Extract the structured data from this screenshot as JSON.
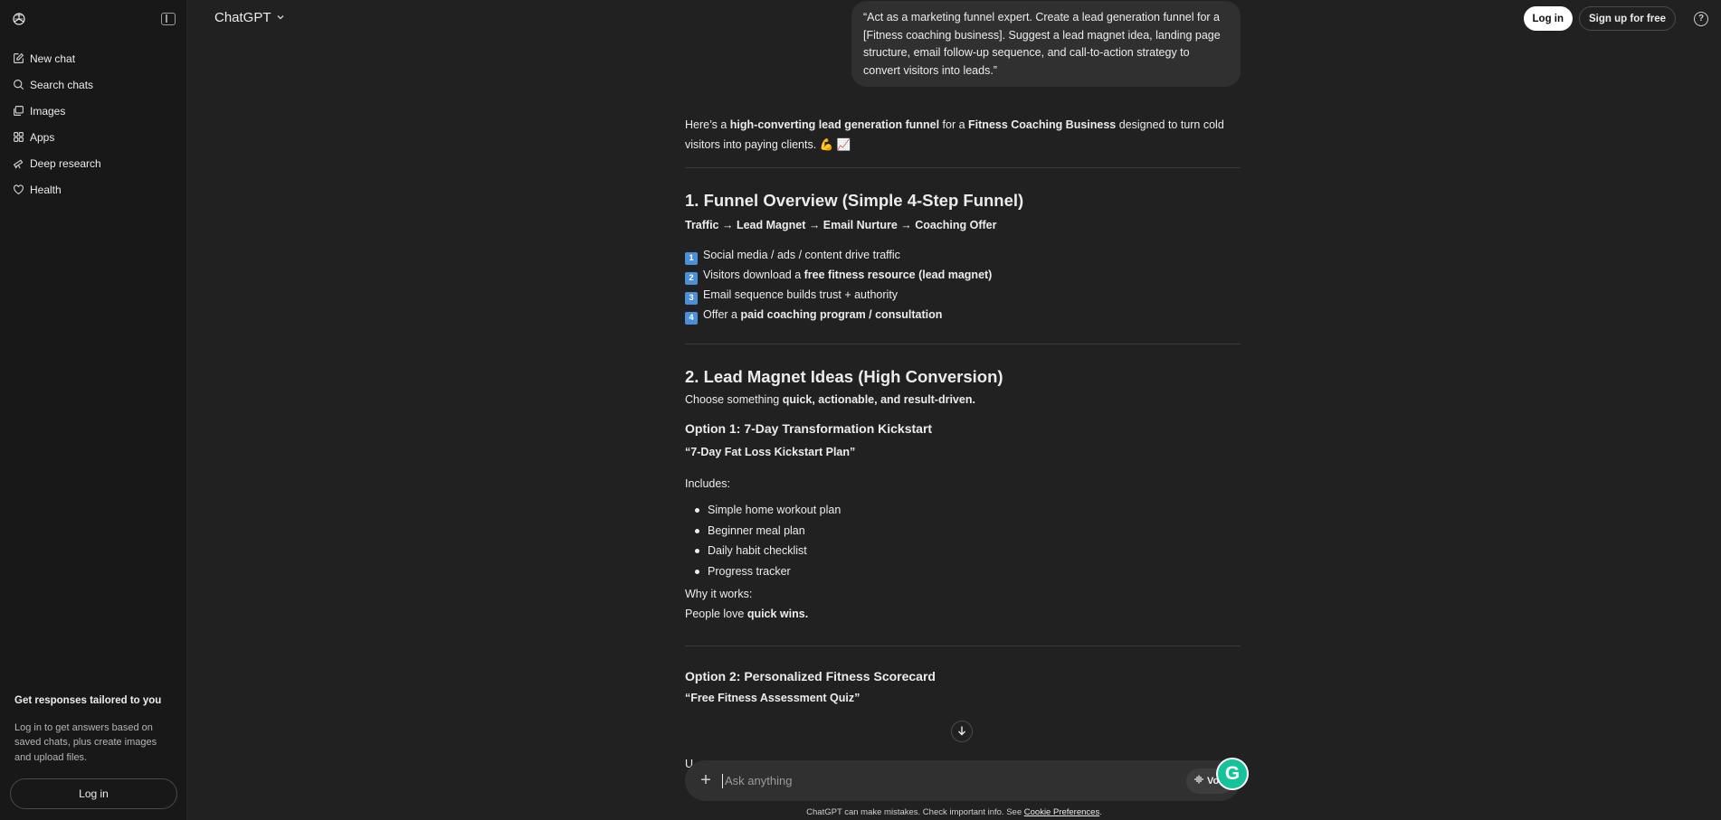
{
  "sidebar": {
    "items": [
      {
        "label": "New chat",
        "icon": "new-chat-icon"
      },
      {
        "label": "Search chats",
        "icon": "search-icon"
      },
      {
        "label": "Images",
        "icon": "images-icon"
      },
      {
        "label": "Apps",
        "icon": "apps-icon"
      },
      {
        "label": "Deep research",
        "icon": "telescope-icon"
      },
      {
        "label": "Health",
        "icon": "heart-icon"
      }
    ],
    "promo_title": "Get responses tailored to you",
    "promo_text": "Log in to get answers based on saved chats, plus create images and upload files.",
    "login_label": "Log in"
  },
  "header": {
    "model_label": "ChatGPT",
    "login_label": "Log in",
    "signup_label": "Sign up for free",
    "help_label": "?"
  },
  "user_message": "“Act as a marketing funnel expert. Create a lead generation funnel for a [Fitness coaching business]. Suggest a lead magnet idea, landing page structure, email follow-up sequence, and call-to-action strategy to convert visitors into leads.”",
  "response": {
    "intro": {
      "t1": "Here’s a ",
      "b1": "high-converting lead generation funnel",
      "t2": " for a ",
      "b2": "Fitness Coaching Business",
      "t3": " designed to turn cold visitors into paying clients. 💪 📈"
    },
    "s1": {
      "heading": "1. Funnel Overview (Simple 4-Step Funnel)",
      "flow": "Traffic → Lead Magnet → Email Nurture → Coaching Offer",
      "steps": [
        {
          "num": "1",
          "text": "Social media / ads / content drive traffic",
          "pre": "",
          "bold": "",
          "post": ""
        },
        {
          "num": "2",
          "text": "",
          "pre": "Visitors download a ",
          "bold": "free fitness resource (lead magnet)",
          "post": ""
        },
        {
          "num": "3",
          "text": "Email sequence builds trust + authority",
          "pre": "",
          "bold": "",
          "post": ""
        },
        {
          "num": "4",
          "text": "",
          "pre": "Offer a ",
          "bold": "paid coaching program / consultation",
          "post": ""
        }
      ]
    },
    "s2": {
      "heading": "2. Lead Magnet Ideas (High Conversion)",
      "choose_pre": "Choose something ",
      "choose_bold": "quick, actionable, and result-driven.",
      "opt1_heading": "Option 1: 7-Day Transformation Kickstart",
      "opt1_title": "“7-Day Fat Loss Kickstart Plan”",
      "includes_label": "Includes:",
      "includes": [
        "Simple home workout plan",
        "Beginner meal plan",
        "Daily habit checklist",
        "Progress tracker"
      ],
      "why_label": "Why it works:",
      "why_pre": "People love ",
      "why_bold": "quick wins.",
      "opt2_heading": "Option 2: Personalized Fitness Scorecard",
      "opt2_title": "“Free Fitness Assessment Quiz”",
      "cut_text": "U"
    }
  },
  "composer": {
    "placeholder": "Ask anything",
    "plus_label": "+",
    "voice_label": "Vo"
  },
  "disclaimer": {
    "text": "ChatGPT can make mistakes. Check important info. See ",
    "link": "Cookie Preferences",
    "end": "."
  },
  "colors": {
    "background": "#212121",
    "sidebar": "#181818",
    "bubble": "#303030",
    "grammarly": "#15c39a",
    "keycap": "#4a8fd8"
  }
}
